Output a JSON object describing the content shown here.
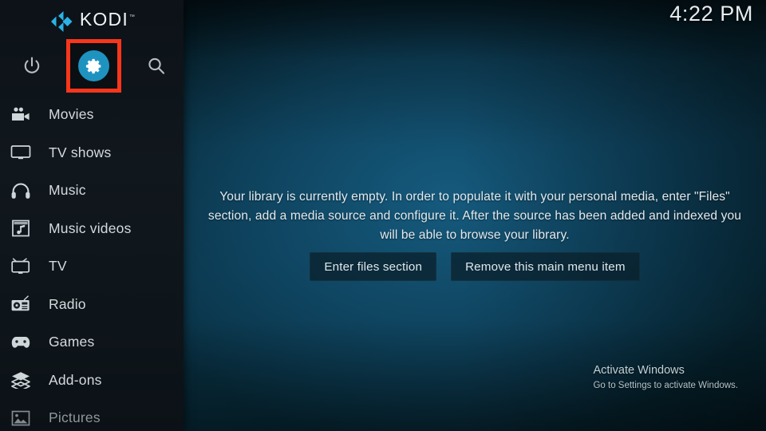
{
  "app": {
    "name": "Kodi",
    "logo_text": "KODI",
    "logo_tm": "™",
    "logo_mark_icon": "kodi-logo-mark",
    "brand_color": "#2bb2e8"
  },
  "clock": {
    "time": "4:22 PM"
  },
  "sidebar": {
    "top_actions": [
      {
        "name": "power-icon",
        "label": "Power",
        "highlighted": false
      },
      {
        "name": "settings-gear-icon",
        "label": "Settings",
        "highlighted": true
      },
      {
        "name": "search-icon",
        "label": "Search",
        "highlighted": false
      }
    ],
    "highlight_color": "#f8361b",
    "gear_circle_color": "#1f93c0",
    "items": [
      {
        "label": "Movies",
        "icon": "movie-camera-icon",
        "dim": false
      },
      {
        "label": "TV shows",
        "icon": "monitor-icon",
        "dim": false
      },
      {
        "label": "Music",
        "icon": "headphones-icon",
        "dim": false
      },
      {
        "label": "Music videos",
        "icon": "music-film-icon",
        "dim": false
      },
      {
        "label": "TV",
        "icon": "television-icon",
        "dim": false
      },
      {
        "label": "Radio",
        "icon": "radio-icon",
        "dim": false
      },
      {
        "label": "Games",
        "icon": "gamepad-icon",
        "dim": false
      },
      {
        "label": "Add-ons",
        "icon": "addon-box-icon",
        "dim": false
      },
      {
        "label": "Pictures",
        "icon": "picture-icon",
        "dim": true
      }
    ]
  },
  "main": {
    "empty_message": "Your library is currently empty. In order to populate it with your personal media, enter \"Files\" section, add a media source and configure it. After the source has been added and indexed you will be able to browse your library.",
    "buttons": [
      {
        "label": "Enter files section",
        "name": "enter-files-section-button"
      },
      {
        "label": "Remove this main menu item",
        "name": "remove-main-menu-item-button"
      }
    ]
  },
  "watermark": {
    "title": "Activate Windows",
    "subtitle": "Go to Settings to activate Windows."
  }
}
